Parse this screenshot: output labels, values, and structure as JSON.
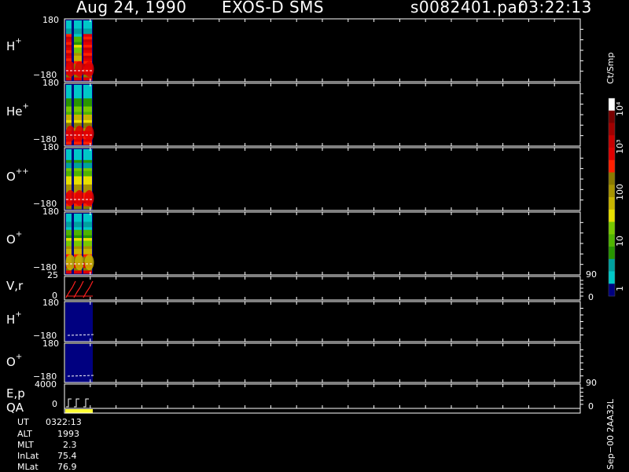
{
  "header": {
    "date": "Aug 24, 1990",
    "instrument": "EXOS-D SMS",
    "file": "s0082401.par",
    "time": "03:22:13"
  },
  "panels": [
    {
      "base": "H",
      "sup": "+",
      "top": "180",
      "bottom": "−180"
    },
    {
      "base": "He",
      "sup": "+",
      "top": "180",
      "bottom": "−180"
    },
    {
      "base": "O",
      "sup": "++",
      "top": "180",
      "bottom": "−180"
    },
    {
      "base": "O",
      "sup": "+",
      "top": "180",
      "bottom": "−180"
    },
    {
      "base": "V,r",
      "sup": "",
      "top": "25",
      "bottom": "0",
      "right_top": "90",
      "right_bottom": "0"
    },
    {
      "base": "H",
      "sup": "+",
      "top": "180",
      "bottom": "−180"
    },
    {
      "base": "O",
      "sup": "+",
      "top": "180",
      "bottom": "−180"
    },
    {
      "base": "E,p",
      "sup": "",
      "top": "4000",
      "bottom": "0",
      "right_top": "90",
      "right_bottom": "0"
    },
    {
      "base": "QA",
      "sup": "",
      "top": "",
      "bottom": ""
    }
  ],
  "colorbar": {
    "unit": "Ct/Smp",
    "labels": [
      "10⁴",
      "10³",
      "100",
      "10",
      "1"
    ],
    "colors": [
      "#ffffff",
      "#7a0000",
      "#a00000",
      "#c80000",
      "#e00000",
      "#ff2000",
      "#8a7a00",
      "#a89400",
      "#c8b400",
      "#e8e000",
      "#78c800",
      "#50b400",
      "#289600",
      "#00a0a0",
      "#00c8c8",
      "#000080"
    ]
  },
  "info": {
    "labels": [
      "UT",
      "ALT",
      "MLT",
      "InLat",
      "MLat"
    ],
    "values": [
      "0322:13",
      "1993",
      "2.3",
      "75.4",
      "76.9"
    ]
  },
  "footer": "Sep−00  2AA32L",
  "colors": {
    "background": "#000000",
    "data_fill": "#000080",
    "vr_marks": "#ff2020",
    "qa_bar": "#ffff33"
  },
  "chart_data": {
    "type": "heatmap",
    "title": "Aug 24, 1990   EXOS-D SMS",
    "panels": [
      "H+",
      "He+",
      "O++",
      "O+",
      "V,r",
      "H+",
      "O+",
      "E,p",
      "QA"
    ],
    "y_ranges": [
      [
        -180,
        180
      ],
      [
        -180,
        180
      ],
      [
        -180,
        180
      ],
      [
        -180,
        180
      ],
      [
        0,
        25
      ],
      [
        -180,
        180
      ],
      [
        -180,
        180
      ],
      [
        0,
        4000
      ]
    ],
    "right_axis_ranges": {
      "V,r": [
        0,
        90
      ],
      "E,p": [
        0,
        90
      ]
    },
    "colorbar_unit": "Ct/Smp",
    "colorbar_scale": "log",
    "colorbar_range": [
      1,
      10000
    ],
    "grid": true,
    "spin_columns": 3,
    "data_extent_fraction": 0.055
  }
}
